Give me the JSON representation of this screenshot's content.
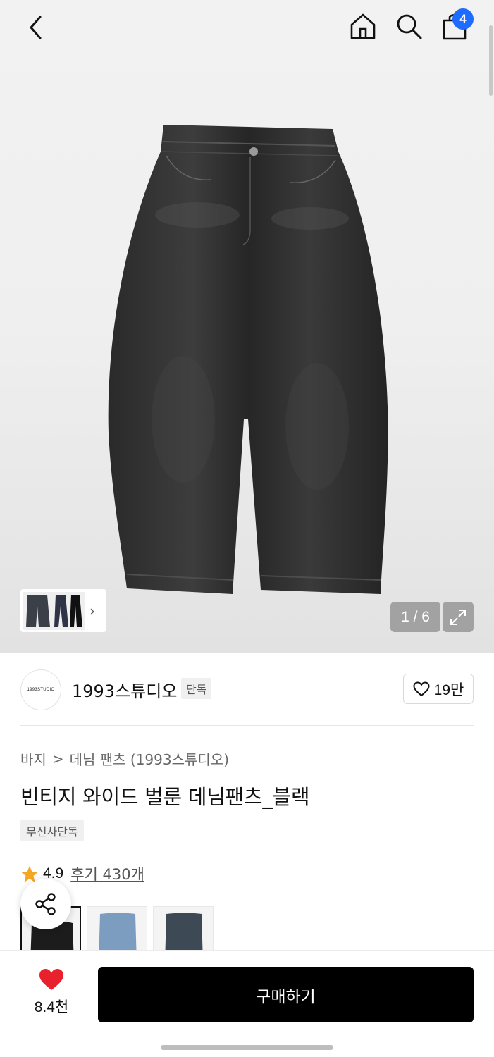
{
  "header": {
    "back_icon": "chevron-left-icon",
    "home_icon": "home-icon",
    "search_icon": "search-icon",
    "cart_icon": "shopping-bag-icon",
    "cart_count": "4",
    "cart_badge_color": "#1e6bff"
  },
  "gallery": {
    "page_indicator": "1 / 6",
    "expand_icon": "expand-icon",
    "thumbnail_chevron": "›"
  },
  "brand": {
    "logo_text": "1993STUDIO",
    "name": "1993스튜디오",
    "exclusive_label": "단독",
    "like_count": "19만"
  },
  "breadcrumb": {
    "category": "바지",
    "separator": ">",
    "subcategory": "데님 팬츠 (1993스튜디오)"
  },
  "product": {
    "title": "빈티지 와이드 벌룬 데님팬츠_블랙",
    "store_tag": "무신사단독",
    "rating": "4.9",
    "review_link": "후기 430개",
    "rating_star_color": "#f5a623"
  },
  "color_options": [
    "black",
    "light-blue",
    "dark-wash"
  ],
  "bottom_bar": {
    "wish_count": "8.4천",
    "wish_heart_color": "#e8212d",
    "buy_label": "구매하기"
  }
}
